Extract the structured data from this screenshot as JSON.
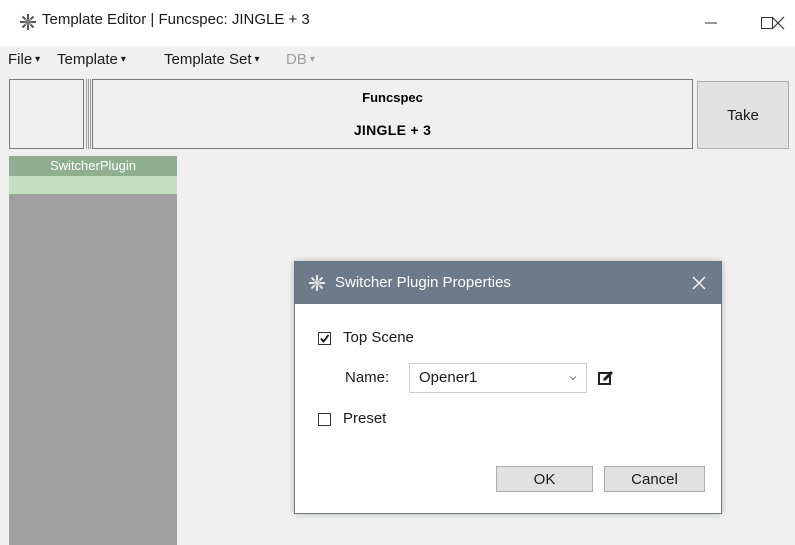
{
  "window": {
    "title": "Template Editor | Funcspec: JINGLE + 3",
    "icon": "sprocket-icon",
    "controls": [
      "minimize-icon",
      "maximize-icon",
      "close-icon"
    ]
  },
  "menu": {
    "file": "File",
    "template": "Template",
    "template_set": "Template Set",
    "db": "DB",
    "caret": "▾"
  },
  "header": {
    "line1": "Funcspec",
    "line2": "JINGLE + 3",
    "take_label": "Take"
  },
  "plugins": {
    "header": "SwitcherPlugin",
    "colors": {
      "header": "#8fae8f",
      "selected_row": "#c3e0c0",
      "column": "#a0a0a0"
    }
  },
  "dialog": {
    "title": "Switcher Plugin Properties",
    "top_scene_label": "Top Scene",
    "top_scene_checked": true,
    "name_label": "Name:",
    "name_value": "Opener1",
    "preset_label": "Preset",
    "preset_checked": false,
    "ok_label": "OK",
    "cancel_label": "Cancel",
    "title_color": "#6d7a8a"
  }
}
